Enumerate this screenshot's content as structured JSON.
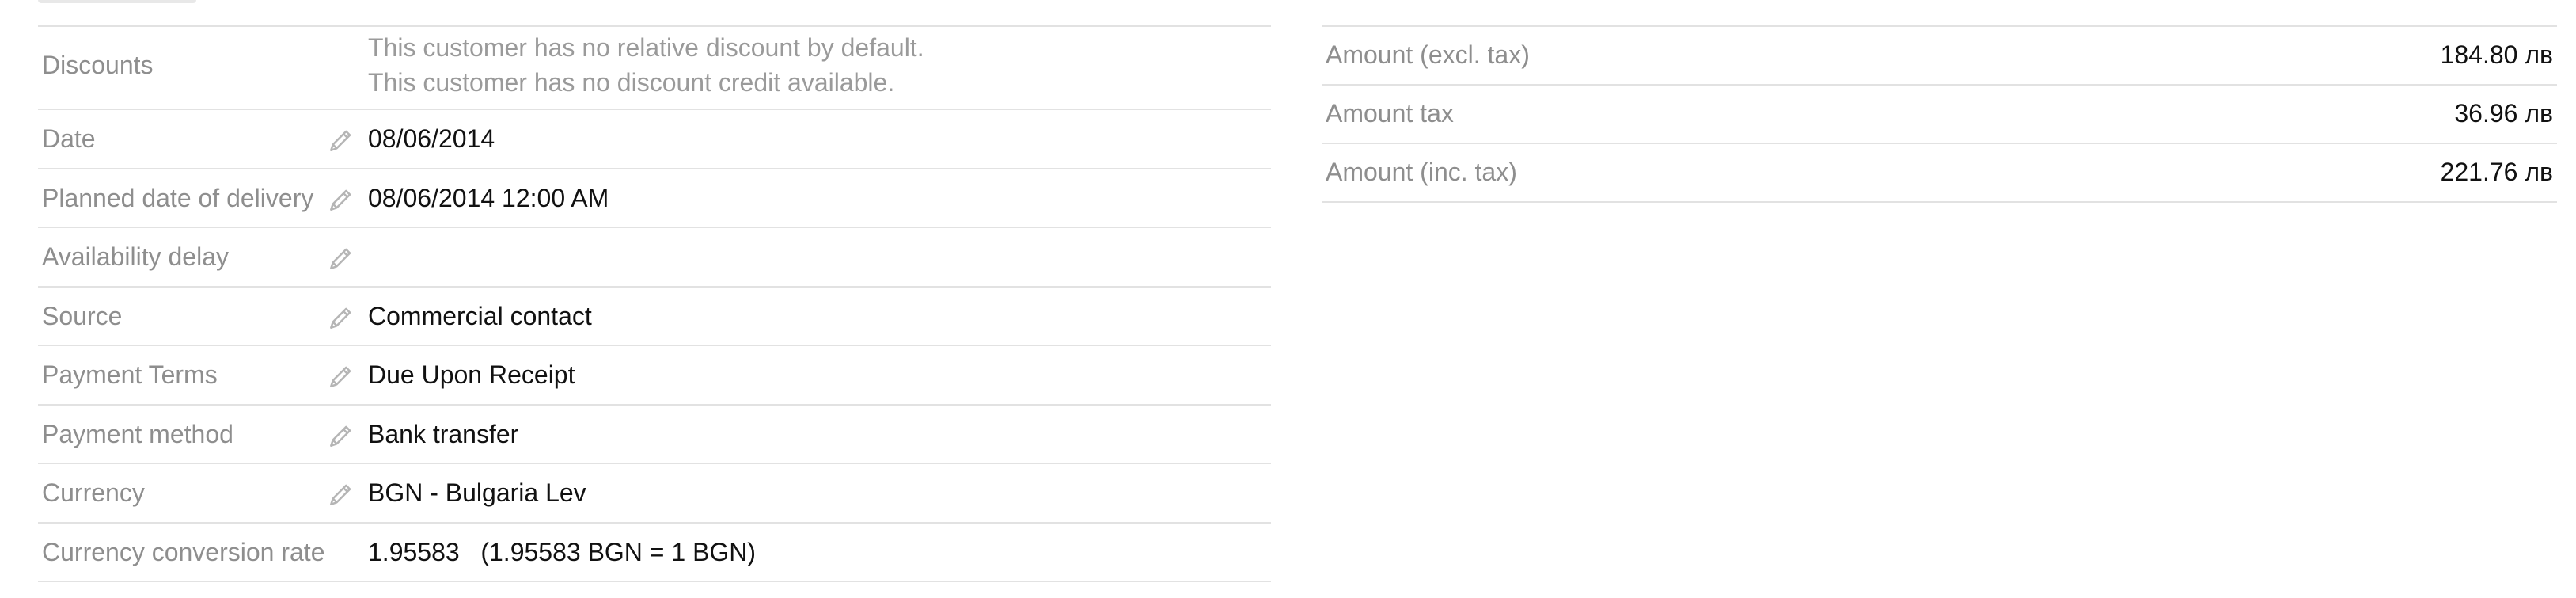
{
  "order_info": {
    "discounts": {
      "label": "Discounts",
      "line1": "This customer has no relative discount by default.",
      "line2": "This customer has no discount credit available."
    },
    "fields": [
      {
        "label": "Date",
        "value": "08/06/2014",
        "editable": true
      },
      {
        "label": "Planned date of delivery",
        "value": "08/06/2014 12:00 AM",
        "editable": true
      },
      {
        "label": "Availability delay",
        "value": "",
        "editable": true
      },
      {
        "label": "Source",
        "value": "Commercial contact",
        "editable": true
      },
      {
        "label": "Payment Terms",
        "value": "Due Upon Receipt",
        "editable": true
      },
      {
        "label": "Payment method",
        "value": "Bank transfer",
        "editable": true
      },
      {
        "label": "Currency",
        "value": "BGN - Bulgaria Lev",
        "editable": true
      },
      {
        "label": "Currency conversion rate",
        "value": "1.95583   (1.95583 BGN = 1 BGN)",
        "editable": false
      }
    ]
  },
  "amounts": [
    {
      "label": "Amount (excl. tax)",
      "value": "184.80 лв"
    },
    {
      "label": "Amount tax",
      "value": "36.96 лв"
    },
    {
      "label": "Amount (inc. tax)",
      "value": "221.76 лв"
    }
  ],
  "icons": {
    "edit": "pencil-icon"
  }
}
